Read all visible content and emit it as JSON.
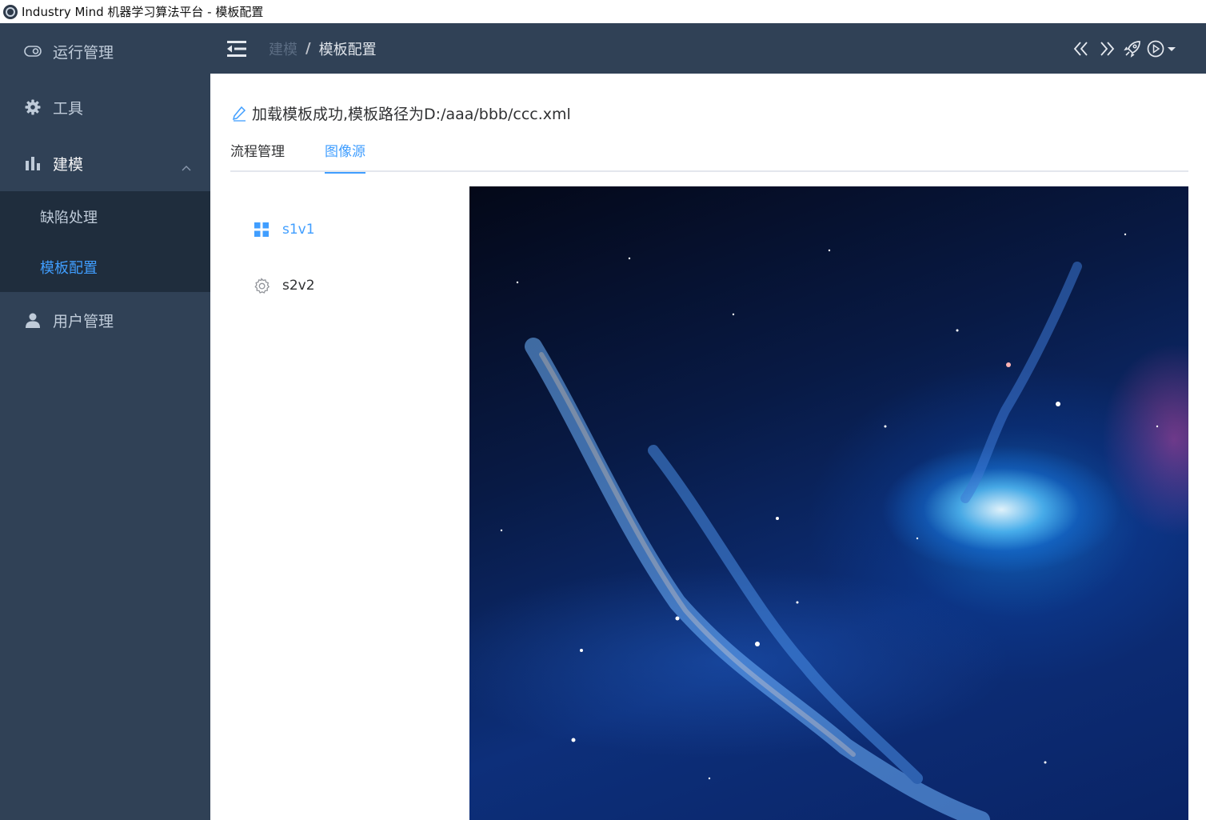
{
  "window": {
    "title": "Industry Mind 机器学习算法平台 - 模板配置"
  },
  "sidebar": {
    "items": [
      {
        "label": "运行管理",
        "icon": "toggle-icon"
      },
      {
        "label": "工具",
        "icon": "gear-icon"
      },
      {
        "label": "建模",
        "icon": "bar-chart-icon",
        "expanded": true,
        "children": [
          {
            "label": "缺陷处理"
          },
          {
            "label": "模板配置",
            "active": true
          }
        ]
      },
      {
        "label": "用户管理",
        "icon": "user-icon"
      }
    ]
  },
  "header": {
    "breadcrumb": [
      "建模",
      "模板配置"
    ],
    "breadcrumb_separator": "/",
    "tools": [
      "double-chevron-left-icon",
      "double-chevron-right-icon",
      "rocket-icon",
      "play-circle-icon"
    ]
  },
  "main": {
    "message": "加载模板成功,模板路径为D:/aaa/bbb/ccc.xml",
    "tabs": [
      {
        "label": "流程管理",
        "active": false
      },
      {
        "label": "图像源",
        "active": true
      }
    ],
    "sources": [
      {
        "label": "s1v1",
        "icon": "grid-icon",
        "active": true
      },
      {
        "label": "s2v2",
        "icon": "gear-outline-icon",
        "active": false
      }
    ],
    "image": {
      "content": "galaxy-nebula"
    }
  },
  "colors": {
    "sidebar_bg": "#304156",
    "submenu_bg": "#1f2d3d",
    "accent": "#409eff",
    "text": "#303133"
  }
}
